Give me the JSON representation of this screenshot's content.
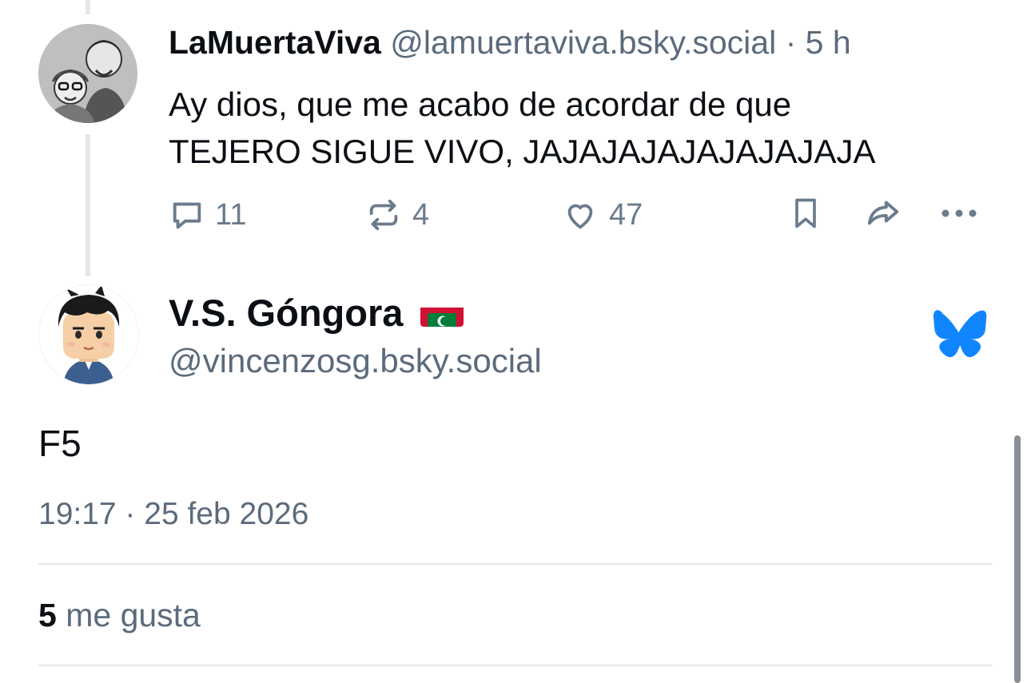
{
  "parent_post": {
    "display_name": "LaMuertaViva",
    "handle": "@lamuertaviva.bsky.social",
    "separator": "·",
    "time_ago": "5 h",
    "text_line1": "Ay dios, que me acabo de acordar de que",
    "text_line2": "TEJERO SIGUE VIVO, JAJAJAJAJAJAJAJAJA",
    "actions": {
      "replies": "11",
      "reposts": "4",
      "likes": "47"
    },
    "icons": [
      "reply-icon",
      "repost-icon",
      "like-icon",
      "bookmark-icon",
      "share-icon",
      "more-icon"
    ]
  },
  "main_post": {
    "display_name": "V.S. Góngora",
    "flag": "maldives-flag",
    "handle": "@vincenzosg.bsky.social",
    "text": "F5",
    "timestamp": "19:17 · 25 feb 2026",
    "likes_count": "5",
    "likes_label": "me gusta"
  },
  "colors": {
    "text": "#0b0f14",
    "muted": "#5b6b7c",
    "divider": "#e3e7ec",
    "bluesky_blue": "#1185fe"
  }
}
